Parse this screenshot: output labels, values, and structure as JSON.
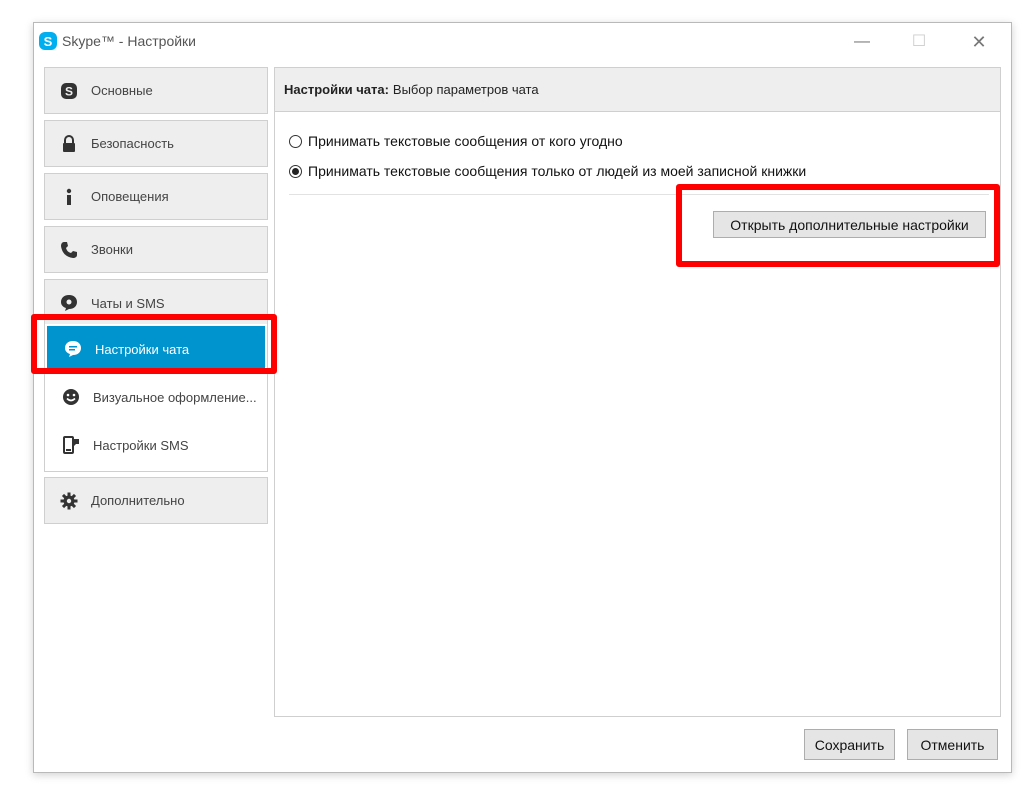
{
  "window": {
    "title": "Skype™ - Настройки",
    "controls": {
      "minimize": "—",
      "maximize": "☐",
      "close": "✕"
    }
  },
  "sidebar": {
    "items": [
      {
        "label": "Основные",
        "icon": "skype-icon"
      },
      {
        "label": "Безопасность",
        "icon": "lock-icon"
      },
      {
        "label": "Оповещения",
        "icon": "info-icon"
      },
      {
        "label": "Звонки",
        "icon": "phone-icon"
      },
      {
        "label": "Чаты и SMS",
        "icon": "chat-bubble-icon"
      }
    ],
    "subitems": [
      {
        "label": "Настройки чата",
        "icon": "chat-settings-icon",
        "active": true
      },
      {
        "label": "Визуальное оформление...",
        "icon": "smiley-icon",
        "active": false
      },
      {
        "label": "Настройки SMS",
        "icon": "sms-phone-icon",
        "active": false
      }
    ],
    "advanced": {
      "label": "Дополнительно",
      "icon": "gear-icon"
    }
  },
  "panel": {
    "header_bold": "Настройки чата:",
    "header_text": "Выбор параметров чата",
    "options": [
      {
        "label": "Принимать текстовые сообщения от кого угодно",
        "checked": false
      },
      {
        "label": "Принимать текстовые сообщения только от людей из моей записной книжки",
        "checked": true
      }
    ],
    "advanced_button": "Открыть дополнительные настройки"
  },
  "footer": {
    "save": "Сохранить",
    "cancel": "Отменить"
  },
  "colors": {
    "accent": "#0094cf",
    "highlight": "#ff0000"
  }
}
